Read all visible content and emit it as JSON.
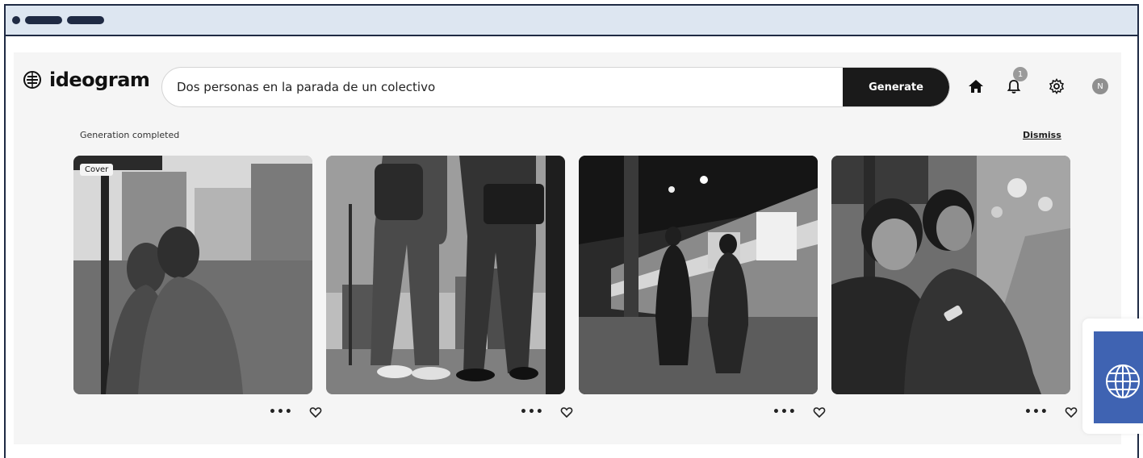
{
  "app": {
    "logo_text": "ideogram",
    "colors": {
      "accent": "#1a1a1a",
      "frame": "#1f2a44",
      "titlebar": "#dde6f1",
      "widget": "#3f63b2"
    }
  },
  "search": {
    "value": "Dos personas en la parada de un colectivo",
    "generate_label": "Generate"
  },
  "header": {
    "icons": [
      "home-icon",
      "bell-icon",
      "gear-icon"
    ],
    "notification_count": "1",
    "avatar_initial": "N"
  },
  "status": {
    "message": "Generation completed",
    "dismiss_label": "Dismiss"
  },
  "results": [
    {
      "cover_label": "Cover",
      "more_label": "•••"
    },
    {
      "more_label": "•••"
    },
    {
      "more_label": "•••"
    },
    {
      "more_label": "•••"
    }
  ],
  "widget": {
    "icon": "globe-icon"
  }
}
